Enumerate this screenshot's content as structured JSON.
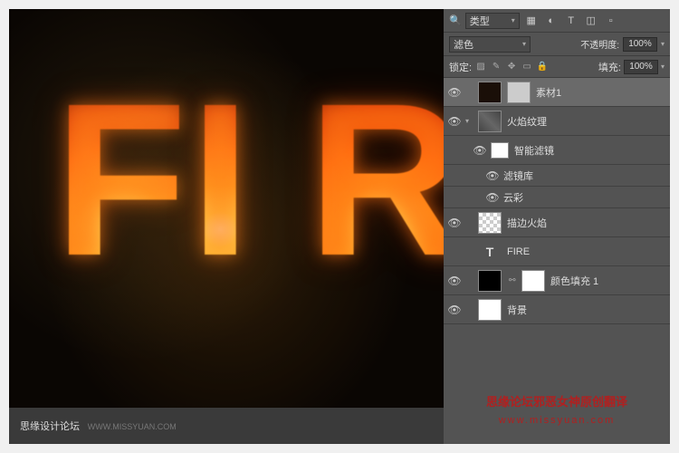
{
  "filterRow": {
    "kindLabel": "类型",
    "searchGlyph": "🔍"
  },
  "blendRow": {
    "mode": "滤色",
    "opacityLabel": "不透明度:",
    "opacityValue": "100%"
  },
  "lockRow": {
    "lockLabel": "锁定:",
    "fillLabel": "填充:",
    "fillValue": "100%"
  },
  "layers": {
    "material1": "素材1",
    "flameTexture": "火焰纹理",
    "smartFilter": "智能滤镜",
    "filterGallery": "滤镜库",
    "clouds": "云彩",
    "strokeFlame": "描边火焰",
    "fireText": "FIRE",
    "colorFill": "颜色填充 1",
    "background": "背景"
  },
  "footer": {
    "site": "思缘设计论坛",
    "url": "WWW.MISSYUAN.COM"
  },
  "watermark": {
    "text": "思缘论坛邪恶女神原创翻译",
    "url": "www.missyuan.com"
  },
  "fxGlyph": "⌃"
}
